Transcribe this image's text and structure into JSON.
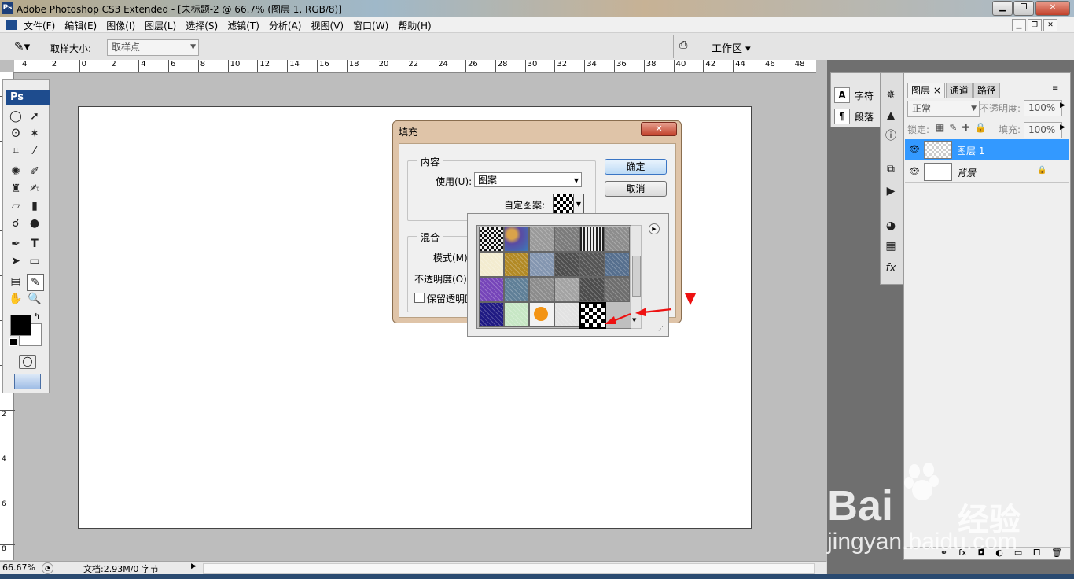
{
  "window": {
    "title": "Adobe Photoshop CS3 Extended - [未标题-2 @ 66.7% (图层 1, RGB/8)]",
    "ps_badge": "Ps"
  },
  "menu": {
    "items": [
      "文件(F)",
      "编辑(E)",
      "图像(I)",
      "图层(L)",
      "选择(S)",
      "滤镜(T)",
      "分析(A)",
      "视图(V)",
      "窗口(W)",
      "帮助(H)"
    ]
  },
  "options": {
    "sample_size_label": "取样大小:",
    "sample_size_value": "取样点",
    "workspace_label": "工作区"
  },
  "rulers": {
    "top_ticks": [
      "4",
      "2",
      "0",
      "2",
      "4",
      "6",
      "8",
      "10",
      "12",
      "14",
      "16",
      "18",
      "20",
      "22",
      "24",
      "26",
      "28",
      "30",
      "32",
      "34",
      "36",
      "38",
      "40",
      "42",
      "44",
      "46",
      "48"
    ],
    "left_ticks": [
      "2",
      "0",
      "2",
      "4",
      "6",
      "8",
      "1",
      "2",
      "4",
      "6",
      "8"
    ]
  },
  "toolbox": {
    "badge": "Ps"
  },
  "dialog": {
    "title": "填充",
    "contents_group": "内容",
    "use_label": "使用(U):",
    "use_value": "图案",
    "custom_pattern_label": "自定图案:",
    "blend_group": "混合",
    "mode_label": "模式(M)",
    "opacity_label": "不透明度(O)",
    "preserve_label": "保留透明区",
    "ok": "确定",
    "cancel": "取消"
  },
  "patterns": [
    [
      "checker",
      "bubbles",
      "clouds-gray",
      "noise-gray",
      "stripes-dark",
      "mottle-gray"
    ],
    [
      "yellow-speck",
      "gold",
      "blue-gray",
      "dark-grid",
      "dark-mottle",
      "slate-blue"
    ],
    [
      "purple",
      "steel-blue",
      "gray-mottle",
      "gray-noise",
      "dark-diagonal",
      "charcoal"
    ],
    [
      "navy-fiber",
      "green-fiber",
      "orange-flower",
      "white-noise",
      "checker-large"
    ]
  ],
  "pattern_colors": {
    "checker": "#222",
    "bubbles": "#5a4ba3",
    "clouds-gray": "#9a9a9a",
    "noise-gray": "#7b7b7b",
    "stripes-dark": "#f0f0f0",
    "mottle-gray": "#8d8d8d",
    "yellow-speck": "#f3ecd0",
    "gold": "#b28a25",
    "blue-gray": "#8496b0",
    "dark-grid": "#4e4e4e",
    "dark-mottle": "#555",
    "slate-blue": "#566f8e",
    "purple": "#7645b9",
    "steel-blue": "#5f7f97",
    "gray-mottle": "#8c8c8c",
    "gray-noise": "#a3a3a3",
    "dark-diagonal": "#4c4c4c",
    "charcoal": "#6e6e6e",
    "navy-fiber": "#1f1a83",
    "green-fiber": "#c7e7c5",
    "orange-flower": "#f2f2f2",
    "white-noise": "#e2e2e2",
    "checker-large": "#ffffff"
  },
  "panels": {
    "char_label": "字符",
    "para_label": "段落",
    "tabs": [
      "图层",
      "通道",
      "路径"
    ],
    "blend_mode": "正常",
    "opacity_label": "不透明度:",
    "opacity_value": "100%",
    "lock_label": "锁定:",
    "fill_label": "填充:",
    "fill_value": "100%",
    "layers": [
      {
        "name": "图层 1",
        "selected": true
      },
      {
        "name": "背景",
        "selected": false
      }
    ]
  },
  "status": {
    "zoom": "66.67%",
    "doc_info": "文档:2.93M/0 字节"
  },
  "watermark": {
    "brand": "Bai",
    "brand2": "经验",
    "url": "jingyan.baidu.com"
  },
  "colors": {
    "accent": "#3399ff",
    "arrow": "#ee1111"
  }
}
